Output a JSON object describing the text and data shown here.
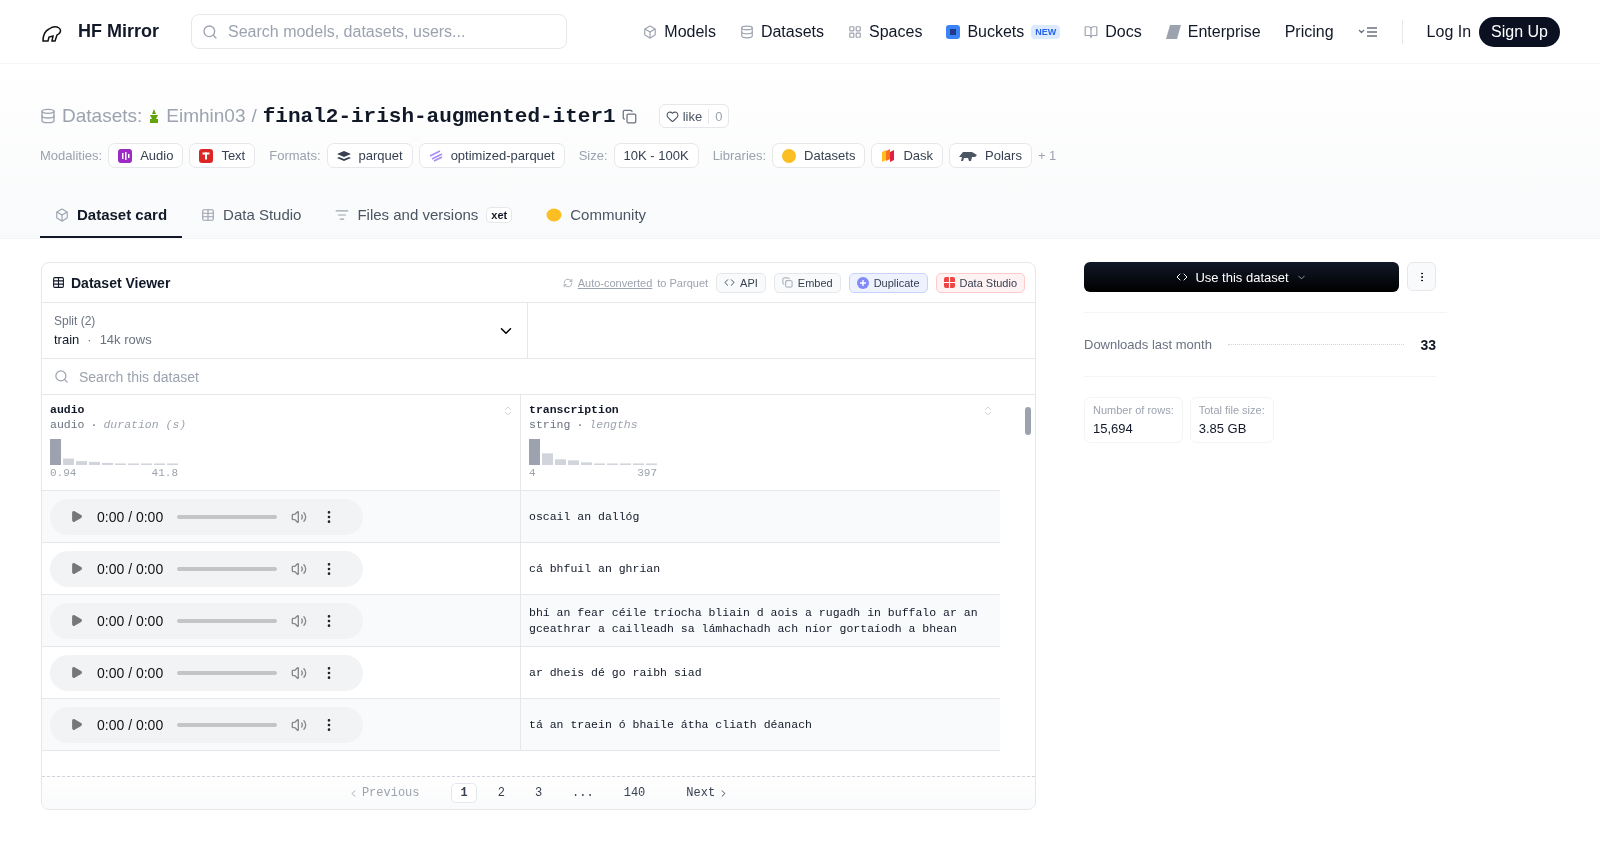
{
  "nav": {
    "brand": "HF Mirror",
    "search_placeholder": "Search models, datasets, users...",
    "items": [
      {
        "label": "Models",
        "kind": "cube"
      },
      {
        "label": "Datasets",
        "kind": "database"
      },
      {
        "label": "Spaces",
        "kind": "grid"
      },
      {
        "label": "Buckets",
        "kind": "bucket",
        "badge": "NEW"
      },
      {
        "label": "Docs",
        "kind": "book"
      },
      {
        "label": "Enterprise",
        "kind": "enterprise"
      },
      {
        "label": "Pricing",
        "kind": "plain"
      }
    ],
    "login": "Log In",
    "signup": "Sign Up"
  },
  "repo": {
    "section": "Datasets:",
    "owner": "Eimhin03",
    "separator": "/",
    "name": "final2-irish-augmented-iter1",
    "like": "like",
    "likes": "0"
  },
  "tag_groups": [
    {
      "label": "Modalities:",
      "tags": [
        {
          "label": "Audio",
          "kind": "audio"
        },
        {
          "label": "Text",
          "kind": "text"
        }
      ]
    },
    {
      "label": "Formats:",
      "tags": [
        {
          "label": "parquet",
          "kind": "parquet"
        },
        {
          "label": "optimized-parquet",
          "kind": "optimized"
        }
      ]
    },
    {
      "label": "Size:",
      "tags": [
        {
          "label": "10K - 100K",
          "kind": "plain"
        }
      ]
    },
    {
      "label": "Libraries:",
      "tags": [
        {
          "label": "Datasets",
          "kind": "hug"
        },
        {
          "label": "Dask",
          "kind": "dask"
        },
        {
          "label": "Polars",
          "kind": "polars"
        }
      ],
      "more": "+ 1"
    }
  ],
  "tabs": [
    {
      "label": "Dataset card",
      "kind": "cube",
      "selected": true
    },
    {
      "label": "Data Studio",
      "kind": "table",
      "selected": false
    },
    {
      "label": "Files and versions",
      "kind": "files",
      "badge": "xet",
      "selected": false
    },
    {
      "label": "Community",
      "kind": "hands",
      "selected": false
    }
  ],
  "viewer": {
    "title": "Dataset Viewer",
    "converted_link": "Auto-converted",
    "converted_rest": "to Parquet",
    "actions": [
      {
        "label": "API",
        "kind": "api"
      },
      {
        "label": "Embed",
        "kind": "embed"
      },
      {
        "label": "Duplicate",
        "kind": "duplicate"
      },
      {
        "label": "Data Studio",
        "kind": "studio"
      }
    ],
    "split": {
      "label": "Split (2)",
      "value": "train",
      "separator": "·",
      "rows": "14k rows"
    },
    "search_placeholder": "Search this dataset",
    "columns": [
      {
        "name": "audio",
        "type": "audio",
        "separator": "·",
        "stat": "duration (s)",
        "min": "0.94",
        "max": "41.8"
      },
      {
        "name": "transcription",
        "type": "string",
        "separator": "·",
        "stat": "lengths",
        "min": "4",
        "max": "397"
      }
    ],
    "rows": [
      {
        "time": "0:00 / 0:00",
        "text": "oscail an dallóg"
      },
      {
        "time": "0:00 / 0:00",
        "text": "cá bhfuil an ghrian"
      },
      {
        "time": "0:00 / 0:00",
        "text": "bhí an fear céile tríocha bliain d aois a rugadh in buffalo ar an gceathrar a cailleadh sa lámhachadh ach níor gortaíodh a bhean"
      },
      {
        "time": "0:00 / 0:00",
        "text": "ar dheis dé go raibh siad"
      },
      {
        "time": "0:00 / 0:00",
        "text": "tá an traein ó bhaile átha cliath déanach"
      }
    ],
    "pagination": {
      "previous": "Previous",
      "next": "Next",
      "pages": [
        {
          "label": "1",
          "selected": true
        },
        {
          "label": "2",
          "selected": false
        },
        {
          "label": "3",
          "selected": false
        },
        {
          "label": "...",
          "selected": false
        },
        {
          "label": "140",
          "selected": false
        }
      ]
    }
  },
  "sidebar": {
    "use_button": "Use this dataset",
    "downloads_label": "Downloads last month",
    "downloads": "33",
    "stats": [
      {
        "label": "Number of rows:",
        "value": "15,694"
      },
      {
        "label": "Total file size:",
        "value": "3.85 GB"
      }
    ]
  }
}
